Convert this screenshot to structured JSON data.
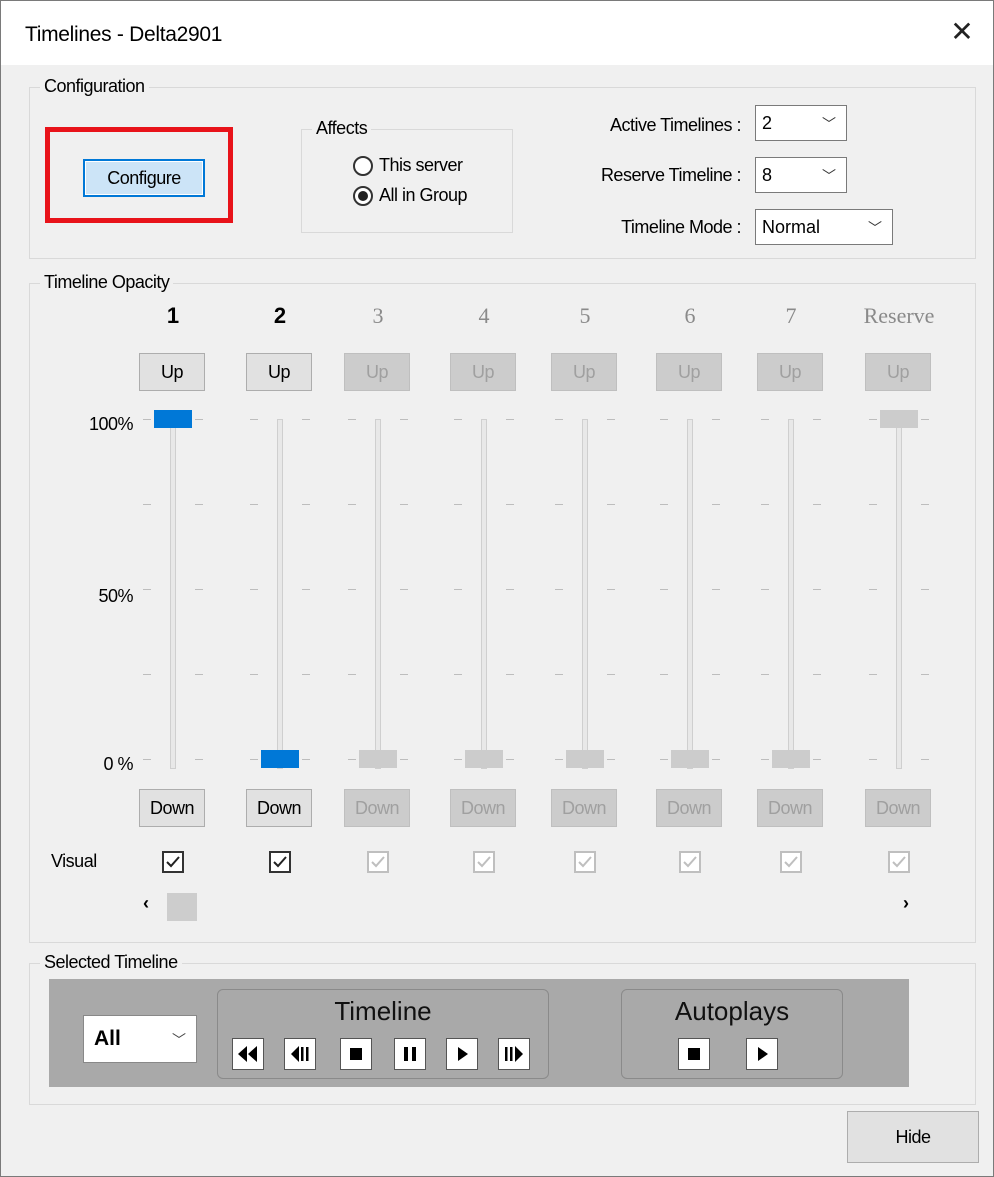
{
  "window": {
    "title": "Timelines - Delta2901",
    "close_glyph": "✕"
  },
  "configuration": {
    "group_label": "Configuration",
    "configure_label": "Configure",
    "affects": {
      "label": "Affects",
      "options": [
        "This server",
        "All in Group"
      ],
      "selected": "All in Group"
    },
    "active_timelines": {
      "label": "Active Timelines :",
      "value": "2"
    },
    "reserve_timeline": {
      "label": "Reserve Timeline :",
      "value": "8"
    },
    "timeline_mode": {
      "label": "Timeline Mode :",
      "value": "Normal"
    }
  },
  "opacity": {
    "group_label": "Timeline Opacity",
    "scale": [
      "100%",
      "50%",
      "0 %"
    ],
    "up_label": "Up",
    "down_label": "Down",
    "visual_label": "Visual",
    "columns": [
      {
        "name": "1",
        "active": true,
        "level": 1.0,
        "visual": true
      },
      {
        "name": "2",
        "active": true,
        "level": 0.0,
        "visual": true
      },
      {
        "name": "3",
        "active": false,
        "level": 0.0,
        "visual": true
      },
      {
        "name": "4",
        "active": false,
        "level": 0.0,
        "visual": true
      },
      {
        "name": "5",
        "active": false,
        "level": 0.0,
        "visual": true
      },
      {
        "name": "6",
        "active": false,
        "level": 0.0,
        "visual": true
      },
      {
        "name": "7",
        "active": false,
        "level": 0.0,
        "visual": true
      },
      {
        "name": "Reserve",
        "active": false,
        "level": 1.0,
        "visual": true
      }
    ],
    "scroll_left": "‹",
    "scroll_right": "›"
  },
  "selected_timeline": {
    "group_label": "Selected Timeline",
    "selector_value": "All",
    "timeline_title": "Timeline",
    "timeline_buttons": [
      "rewind-icon",
      "step-back-icon",
      "stop-icon",
      "pause-icon",
      "play-icon",
      "step-forward-icon"
    ],
    "autoplays_title": "Autoplays",
    "autoplay_buttons": [
      "stop-icon",
      "play-icon"
    ]
  },
  "footer": {
    "hide_label": "Hide"
  },
  "colors": {
    "accent": "#0078d7",
    "highlight": "#e8131a",
    "panel": "#a9a9a9",
    "disabled": "#a0a0a0"
  }
}
